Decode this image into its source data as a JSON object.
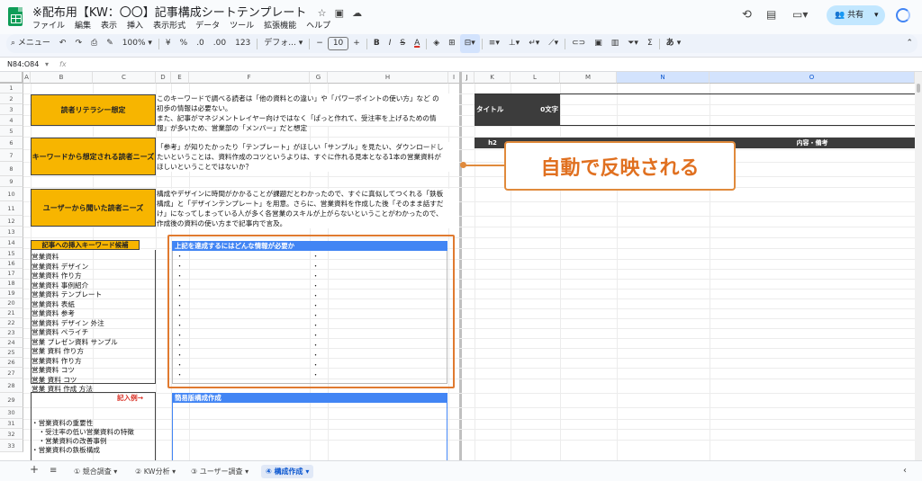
{
  "app": {
    "title": "※配布用【KW：〇〇】記事構成シートテンプレート",
    "menus": [
      "ファイル",
      "編集",
      "表示",
      "挿入",
      "表示形式",
      "データ",
      "ツール",
      "拡張機能",
      "ヘルプ"
    ],
    "share_label": "共有"
  },
  "toolbar": {
    "menu_label": "メニュー",
    "zoom": "100%",
    "yen": "¥",
    "percent": "%",
    "dec_down": ".0",
    "dec_up": ".00",
    "num_format": "123",
    "font": "デフォ...",
    "font_size": "10",
    "bold": "B",
    "italic": "I",
    "strike": "S",
    "text_color": "A",
    "input_tools": "あ"
  },
  "formula": {
    "cell_ref": "N84:O84",
    "fx": "fx"
  },
  "columns": [
    "A",
    "B",
    "C",
    "D",
    "E",
    "F",
    "G",
    "H",
    "I",
    "J",
    "K",
    "L",
    "M",
    "N",
    "O"
  ],
  "rows": [
    "1",
    "2",
    "3",
    "4",
    "5",
    "6",
    "7",
    "8",
    "9",
    "10",
    "11",
    "12",
    "13",
    "14",
    "15",
    "16",
    "17",
    "18",
    "19",
    "20",
    "21",
    "22",
    "23",
    "24",
    "25",
    "26",
    "27",
    "28",
    "29",
    "30",
    "31",
    "32",
    "33"
  ],
  "sections": {
    "literacy_label": "読者リテラシー想定",
    "literacy_text": [
      "このキーワードで調べる読者は「他の資料との違い」や「パワーポイントの使い方」など の",
      "初歩の情報は必要ない。",
      "また、記事がマネジメントレイヤー向けではなく「ぱっと作れて、受注率を上げるための情",
      "報」が多いため、営業部の「メンバー」だと想定"
    ],
    "needs_label": "キーワードから想定される読者ニーズ",
    "needs_text": [
      "「参考」が知りたかったり「テンプレート」がほしい「サンプル」を見たい、ダウンロードし",
      "たいということは、資料作成のコツというよりは、すぐに作れる見本となる1本の営業資料が",
      "ほしいということではないか？"
    ],
    "heard_label": "ユーザーから聞いた読者ニーズ",
    "heard_text": [
      "構成やデザインに時間がかかることが課題だとわかったので、すぐに真似してつくれる「鉄板",
      "構成」と「デザインテンプレート」を用意。さらに、営業資料を作成した後「そのまま話すだ",
      "け」になってしまっている人が多く各営業のスキルが上がらないということがわかったので、",
      "作成後の資料の使い方まで記事内で言及。"
    ],
    "keywords_label": "記事への挿入キーワード候補",
    "keywords": [
      "営業資料",
      "営業資料 デザイン",
      "営業資料 作り方",
      "営業資料 事例紹介",
      "営業資料 テンプレート",
      "営業資料 表紙",
      "営業資料 参考",
      "営業資料 デザイン 外注",
      "営業資料 ペライチ",
      "営業 プレゼン資料 サンプル",
      "営業 資料 作り方",
      "営業資料 作り方",
      "営業資料 コツ",
      "営業 資料 コツ",
      "営業 資料 作成 方法"
    ],
    "info_needed_label": "上記を達成するにはどんな情報が必要か",
    "bullet": "・",
    "example_label": "記入例→",
    "example_items": [
      "・営業資料の重要性",
      "　・受注率の低い営業資料の特徴",
      "　・営業資料の改善事例",
      "・営業資料の鉄板構成"
    ],
    "simple_outline_label": "簡易版構成作成"
  },
  "right_panel": {
    "title_label": "タイトル",
    "char_count": "0文字",
    "h2_label": "h2",
    "notes_label": "内容・備考"
  },
  "callout": {
    "text": "自動で反映される"
  },
  "sheets": [
    {
      "label": "① 競合調査",
      "active": false
    },
    {
      "label": "② KW分析",
      "active": false
    },
    {
      "label": "③ ユーザー調査",
      "active": false
    },
    {
      "label": "④ 構成作成",
      "active": true
    }
  ],
  "colors": {
    "yellow": "#f7b500",
    "header_blue": "#4285f4",
    "dark_header": "#3c3c3c",
    "callout_orange": "#e07020"
  }
}
